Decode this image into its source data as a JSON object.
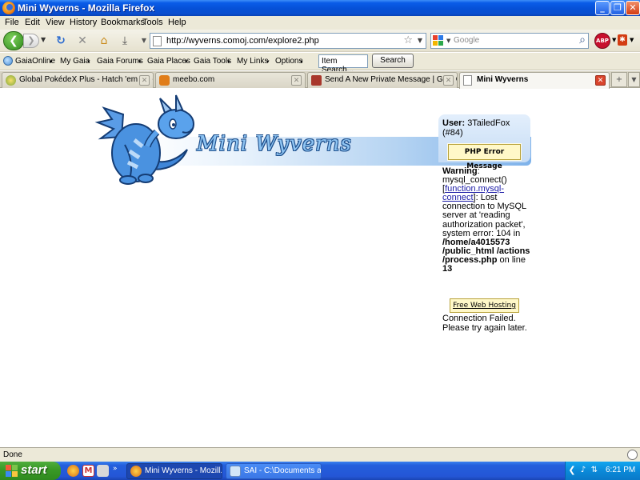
{
  "window": {
    "title": "Mini Wyverns - Mozilla Firefox"
  },
  "menu": [
    "File",
    "Edit",
    "View",
    "History",
    "Bookmarks",
    "Tools",
    "Help"
  ],
  "nav": {
    "url": "http://wyverns.comoj.com/explore2.php",
    "search_placeholder": "Google",
    "adblock_label": "ABP"
  },
  "gaia_toolbar": {
    "items": [
      "GaiaOnline",
      "My Gaia",
      "Gaia Forums",
      "Gaia Places",
      "Gaia Tools",
      "My Links",
      "Options"
    ],
    "item_search_value": "Item Search...",
    "search_button": "Search"
  },
  "tabs": [
    {
      "label": "Global PokédeX Plus - Hatch 'em all! -...",
      "active": false
    },
    {
      "label": "meebo.com",
      "active": false
    },
    {
      "label": "Send A New Private Message | Gaia O...",
      "active": false
    },
    {
      "label": "Mini Wyverns",
      "active": true
    }
  ],
  "page": {
    "banner_title": "Mini Wyverns",
    "user_label": "User:",
    "user_name": "3TailedFox",
    "user_id": "(#84)",
    "php_error_button": "PHP Error Message",
    "warning_label": "Warning",
    "warning_pre": ": mysql_connect() [",
    "warning_link": "function.mysql-connect",
    "warning_mid": "]: Lost connection to MySQL server at 'reading authorization packet', system error: 104 in ",
    "warning_path": "/home/a4015573 /public_html /actions /process.php",
    "warning_on_line": " on line ",
    "warning_line_no": "13",
    "free_hosting_button": "Free Web Hosting",
    "fail_message": "Connection Failed. Please try again later."
  },
  "status": {
    "text": "Done"
  },
  "taskbar": {
    "start_label": "start",
    "tasks": [
      {
        "label": "Mini Wyverns - Mozill...",
        "active": true
      },
      {
        "label": "SAI - C:\\Documents a...",
        "active": false
      }
    ],
    "clock": "6:21 PM"
  },
  "colors": {
    "xp_blue": "#0a5ce8",
    "link": "#1a1aa6",
    "button_yellow": "#fff8c8",
    "banner_blue": "#7eb2ea"
  }
}
